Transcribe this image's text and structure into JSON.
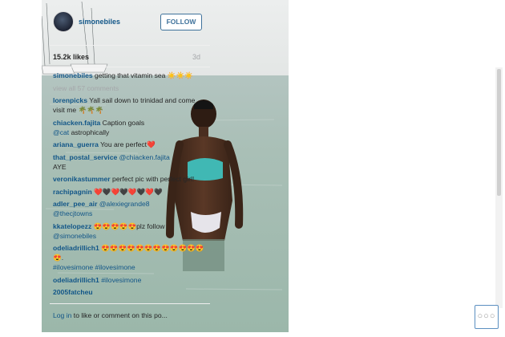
{
  "post": {
    "username": "simonebiles",
    "follow_label": "FOLLOW",
    "likes": "15.2k likes",
    "timestamp": "3d",
    "caption_user": "simonebiles",
    "caption_text": " getting that vitamin sea ☀️☀️☀️",
    "view_all": "view all 57 comments"
  },
  "comments": [
    {
      "user": "lorenpicks",
      "text": " Yall sail down to trinidad and come visit me 🌴🌴🌴"
    },
    {
      "user": "chiacken.fajita",
      "text": " Caption goals",
      "mention": "@cat",
      "after": " astrophically"
    },
    {
      "user": "ariana_guerra",
      "text": " You are perfect❤️"
    },
    {
      "user": "that_postal_service",
      "mention": "@chiacken.fajita",
      "text": " ",
      "after": "AYE"
    },
    {
      "user": "veronikastummer",
      "text": " perfect pic with perfect girl!"
    },
    {
      "user": "rachipagnin",
      "text": " ❤️🖤❤️🖤❤️🖤❤️🖤"
    },
    {
      "user": "adler_pee_air",
      "mention": "@alexiegrande8",
      "text": " ",
      "after": "@thecjtowns"
    },
    {
      "user": "kkatelopezz",
      "text": " 😍😍😍😍😍plz follow",
      "mention2": "@simonebiles"
    },
    {
      "user": "odeliadrillich1",
      "text": " 😍😍😍😍😍😍😍😍😍😍😍😍😍.",
      "mention2": "#ilovesimone #ilovesimone"
    },
    {
      "user": "odeliadrillich1",
      "mention": "#ilovesimone",
      "text": " "
    },
    {
      "user": "2005fatcheu",
      "text": ""
    }
  ],
  "footer": {
    "login_link": "Log in",
    "login_rest": " to like or comment on this po..."
  },
  "more_glyph": "○○○",
  "colors": {
    "link": "#125688",
    "follow_border": "#3f729b",
    "muted": "#a5a7aa"
  }
}
